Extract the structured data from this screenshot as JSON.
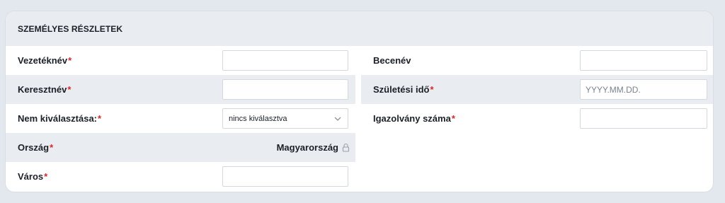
{
  "section": {
    "title": "SZEMÉLYES RÉSZLETEK"
  },
  "required_mark": "*",
  "left": {
    "last_name": {
      "label": "Vezetéknév",
      "value": ""
    },
    "first_name": {
      "label": "Keresztnév",
      "value": ""
    },
    "gender": {
      "label": "Nem kiválasztása:",
      "selected": "nincs kiválasztva"
    },
    "country": {
      "label": "Ország",
      "value": "Magyarország"
    },
    "city": {
      "label": "Város",
      "value": ""
    }
  },
  "right": {
    "nickname": {
      "label": "Becenév",
      "value": ""
    },
    "birth_date": {
      "label": "Születési idő",
      "placeholder": "YYYY.MM.DD.",
      "value": ""
    },
    "id_number": {
      "label": "Igazolvány száma",
      "value": ""
    }
  },
  "icons": {
    "select": "chevron-down-icon",
    "locked": "lock-icon"
  },
  "colors": {
    "required": "#e02424",
    "header_bg": "#e9ecf1",
    "page_bg": "#e3e7ee"
  }
}
